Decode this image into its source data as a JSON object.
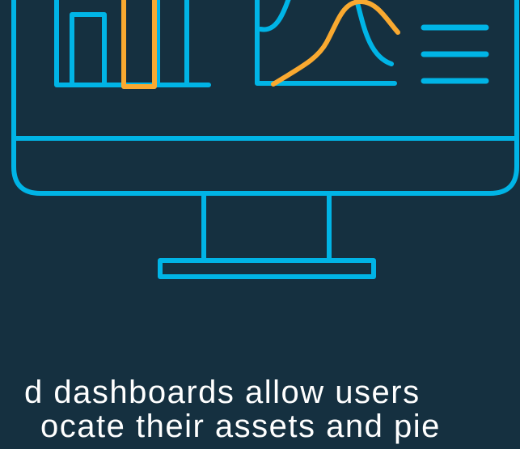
{
  "illustration": {
    "stroke_primary": "#00b4e6",
    "stroke_accent": "#f9a930",
    "background": "#153040",
    "icons": [
      "monitor-icon",
      "bar-chart-icon",
      "line-chart-icon",
      "list-icon"
    ]
  },
  "caption": {
    "line1": "d dashboards allow users",
    "line2": "ocate their assets and pie"
  }
}
